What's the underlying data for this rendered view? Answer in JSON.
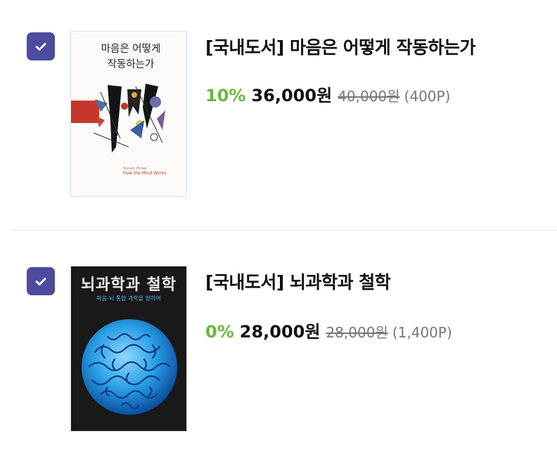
{
  "colors": {
    "checkbox": "#4c4c9e",
    "discount": "#67b93f",
    "divider": "#e3e3e3",
    "strikethrough_price": "#777777"
  },
  "items": [
    {
      "checked": true,
      "title": "[국내도서] 마음은 어떻게 작동하는가",
      "discount": "10%",
      "price": "36,000원",
      "original_price": "40,000원",
      "points": "(400P)",
      "cover": {
        "title_line1": "마음은 어떻게",
        "title_line2": "작동하는가",
        "author": "Steven Pinker",
        "english_title": "How the Mind Works"
      }
    },
    {
      "checked": true,
      "title": "[국내도서] 뇌과학과 철학",
      "discount": "0%",
      "price": "28,000원",
      "original_price": "28,000원",
      "points": "(1,400P)",
      "cover": {
        "title": "뇌과학과 철학",
        "subtitle": "마음-뇌 통합 과학을 향하여"
      }
    }
  ]
}
